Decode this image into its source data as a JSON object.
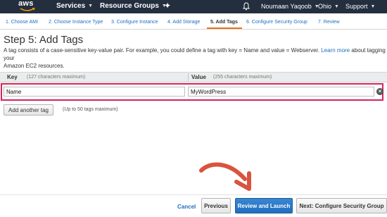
{
  "topnav": {
    "logo": "aws",
    "services": "Services",
    "resource_groups": "Resource Groups",
    "user": "Noumaan Yaqoob",
    "region": "Ohio",
    "support": "Support"
  },
  "wizard_tabs": [
    "1. Choose AMI",
    "2. Choose Instance Type",
    "3. Configure Instance",
    "4. Add Storage",
    "5. Add Tags",
    "6. Configure Security Group",
    "7. Review"
  ],
  "active_tab": "5. Add Tags",
  "page": {
    "title": "Step 5: Add Tags",
    "description_1": "A tag consists of a case-sensitive key-value pair. For example, you could define a tag with key = Name and value = Webserver.",
    "learn_more": "Learn more",
    "description_2": "about tagging your",
    "description_3": "Amazon EC2 resources."
  },
  "table": {
    "key_header": "Key",
    "key_note": "(127 characters maximum)",
    "value_header": "Value",
    "value_note": "(255 characters maximum)",
    "rows": [
      {
        "key": "Name",
        "value": "MyWordPress"
      }
    ]
  },
  "add_tag": {
    "label": "Add another tag",
    "note": "(Up to 50 tags maximum)"
  },
  "footer": {
    "cancel": "Cancel",
    "previous": "Previous",
    "review": "Review and Launch",
    "next": "Next: Configure Security Group"
  },
  "colors": {
    "nav_bg": "#232f3e",
    "accent_orange": "#ec7211",
    "link_blue": "#1f6ec1",
    "highlight_box": "#d6245a",
    "annotation_arrow": "#d9533f"
  }
}
